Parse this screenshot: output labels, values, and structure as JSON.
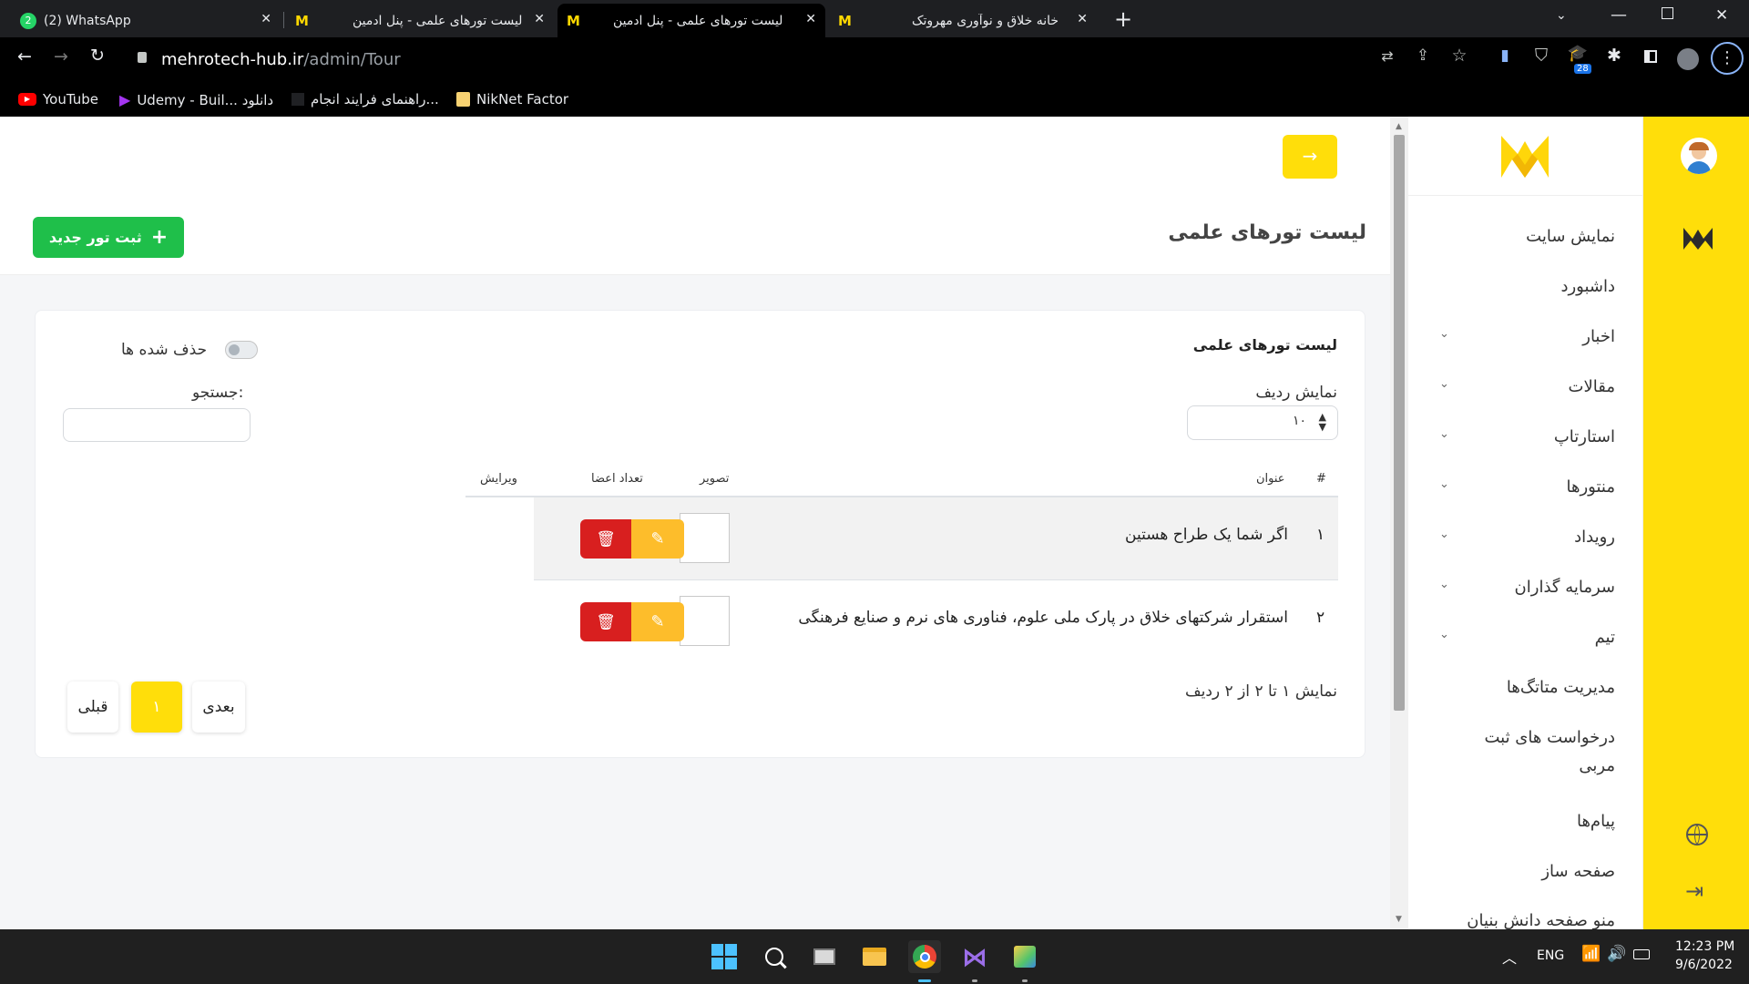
{
  "browser": {
    "tabs": [
      {
        "title": "(2) WhatsApp",
        "badge": "2",
        "active": false
      },
      {
        "title": "لیست تورهای علمی - پنل ادمین",
        "active": false
      },
      {
        "title": "لیست تورهای علمی - پنل ادمین",
        "active": true
      },
      {
        "title": "خانه خلاق و نوآوری مهروتک",
        "active": false
      }
    ],
    "new_tab": "+",
    "url_host": "mehrotech-hub.ir",
    "url_path": "/admin/Tour",
    "extension_badge": "28",
    "bookmarks": [
      {
        "label": "YouTube",
        "icon": "youtube-icon"
      },
      {
        "label": "Udemy - Buil... دانلود",
        "icon": "udemy-icon"
      },
      {
        "label": "راهنمای فرایند انجام...",
        "icon": "page-icon"
      },
      {
        "label": "NikNet Factor",
        "icon": "folder-icon"
      }
    ]
  },
  "sidebar": {
    "items": [
      {
        "label": "نمایش سایت",
        "has_submenu": false
      },
      {
        "label": "داشبورد",
        "has_submenu": false
      },
      {
        "label": "اخبار",
        "has_submenu": true
      },
      {
        "label": "مقالات",
        "has_submenu": true
      },
      {
        "label": "استارتاپ",
        "has_submenu": true
      },
      {
        "label": "منتورها",
        "has_submenu": true
      },
      {
        "label": "رویداد",
        "has_submenu": true
      },
      {
        "label": "سرمایه گذاران",
        "has_submenu": true
      },
      {
        "label": "تیم",
        "has_submenu": true
      },
      {
        "label": "مدیریت متاتگ‌ها",
        "has_submenu": false
      },
      {
        "label": "درخواست های ثبت مربی",
        "has_submenu": false
      },
      {
        "label": "پیام‌ها",
        "has_submenu": false
      },
      {
        "label": "صفحه ساز",
        "has_submenu": false
      },
      {
        "label": "منو صفحه دانش بنیان",
        "has_submenu": false
      }
    ]
  },
  "header": {
    "page_title": "لیست تورهای علمی",
    "add_button": "ثبت تور جدید"
  },
  "card": {
    "title": "لیست تورهای علمی",
    "deleted_toggle_label": "حذف شده ها",
    "deleted_toggle_on": false,
    "page_size_label": "نمایش ردیف",
    "page_size_value": "۱۰",
    "search_label": "جستجو:",
    "search_value": "",
    "columns": {
      "num": "#",
      "title": "عنوان",
      "image": "تصویر",
      "members": "تعداد اعضا",
      "edit": "ویرایش"
    },
    "rows": [
      {
        "num": "۱",
        "title": "اگر شما یک طراح هستین"
      },
      {
        "num": "۲",
        "title": "استقرار شرکتهای خلاق در پارک ملی علوم، فناوری های نرم و صنایع فرهنگی"
      }
    ],
    "info": "نمایش ۱ تا ۲ از ۲ ردیف",
    "pagination": {
      "prev": "قبلی",
      "current": "۱",
      "next": "بعدی"
    }
  },
  "taskbar": {
    "lang": "ENG",
    "time": "12:23 PM",
    "date": "9/6/2022"
  },
  "colors": {
    "brand_yellow": "#ffde0a",
    "green": "#1fbf4a",
    "edit": "#fdbd2b",
    "delete": "#d81f1f"
  }
}
